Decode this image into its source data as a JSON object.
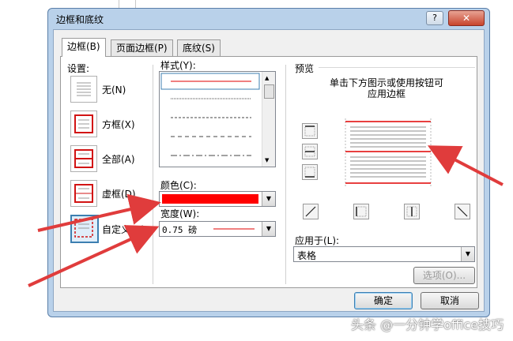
{
  "dialog": {
    "title": "边框和底纹",
    "help_glyph": "?",
    "close_glyph": "✕"
  },
  "tabs": [
    {
      "label": "边框(B)"
    },
    {
      "label": "页面边框(P)"
    },
    {
      "label": "底纹(S)"
    }
  ],
  "settings": {
    "heading": "设置:",
    "items": [
      {
        "label": "无(N)"
      },
      {
        "label": "方框(X)"
      },
      {
        "label": "全部(A)"
      },
      {
        "label": "虚框(D)"
      },
      {
        "label": "自定义(U)"
      }
    ]
  },
  "style": {
    "heading": "样式(Y):"
  },
  "color": {
    "heading": "颜色(C):",
    "value": "#ff0000"
  },
  "width": {
    "heading": "宽度(W):",
    "value": "0.75 磅"
  },
  "preview": {
    "heading": "预览",
    "hint_line1": "单击下方图示或使用按钮可",
    "hint_line2": "应用边框"
  },
  "apply_to": {
    "heading": "应用于(L):",
    "value": "表格"
  },
  "buttons": {
    "options": "选项(O)...",
    "ok": "确定",
    "cancel": "取消"
  },
  "watermark": "头条 @一分钟学office技巧",
  "colors": {
    "accent": "#ff0000",
    "arrow": "#e03c3c",
    "frame": "#b9d1ea"
  }
}
